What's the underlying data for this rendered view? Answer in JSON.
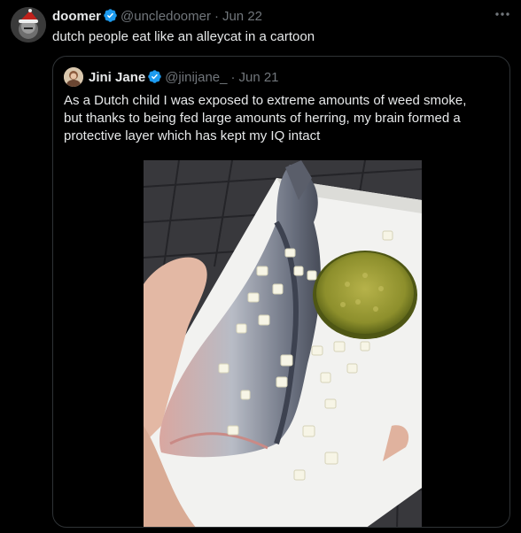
{
  "tweet": {
    "author_name": "doomer",
    "author_handle": "@uncledoomer",
    "separator": "·",
    "date": "Jun 22",
    "text": "dutch people eat like an alleycat in a cartoon",
    "more_icon": "ellipsis-icon"
  },
  "quote": {
    "author_name": "Jini Jane",
    "author_handle": "@jinijane_",
    "separator": "·",
    "date": "Jun 21",
    "text": "As a Dutch child I was exposed to extreme amounts of weed smoke,\nbut thanks to being fed large amounts of herring, my brain formed a\nprotective layer which has kept my IQ intact"
  },
  "colors": {
    "background": "#000000",
    "text": "#e7e9ea",
    "muted": "#71767b",
    "verified": "#1d9bf0",
    "border": "#2f3336"
  }
}
